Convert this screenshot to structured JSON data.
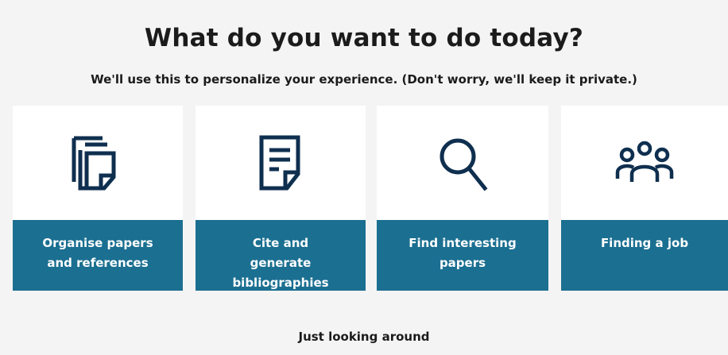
{
  "header": {
    "title": "What do you want to do today?",
    "subtitle": "We'll use this to personalize your experience. (Don't worry, we'll keep it private.)"
  },
  "cards": [
    {
      "label": "Organise papers and references",
      "icon": "documents-stack-icon"
    },
    {
      "label": "Cite and generate bibliographies",
      "icon": "document-lines-icon"
    },
    {
      "label": "Find interesting papers",
      "icon": "search-icon"
    },
    {
      "label": "Finding a job",
      "icon": "people-icon"
    }
  ],
  "footer": {
    "link": "Just looking around"
  },
  "colors": {
    "accent": "#1b6f91",
    "icon": "#0f2f4f",
    "background": "#f4f4f4"
  }
}
